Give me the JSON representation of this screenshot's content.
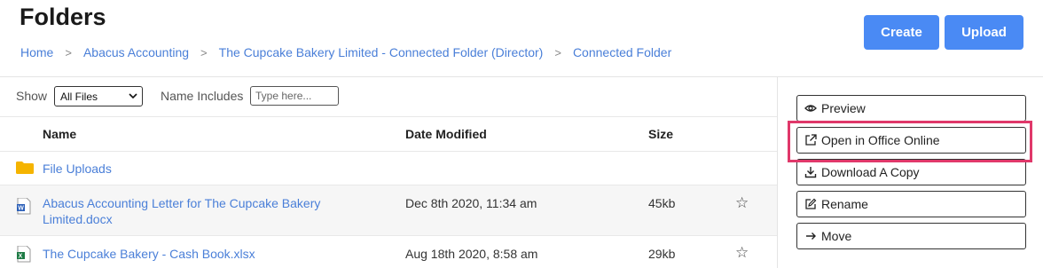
{
  "header": {
    "title": "Folders"
  },
  "breadcrumb": [
    "Home",
    "Abacus Accounting",
    "The Cupcake Bakery Limited - Connected Folder (Director)",
    "Connected Folder"
  ],
  "actions": {
    "create_label": "Create",
    "upload_label": "Upload"
  },
  "filters": {
    "show_label": "Show",
    "show_value": "All Files",
    "name_label": "Name Includes",
    "name_placeholder": "Type here..."
  },
  "table": {
    "columns": [
      "Name",
      "Date Modified",
      "Size"
    ],
    "rows": [
      {
        "type": "folder",
        "name": "File Uploads",
        "date": "",
        "size": ""
      },
      {
        "type": "docx",
        "name_line1": "Abacus Accounting Letter for The Cupcake Bakery",
        "name_line2": "Limited.docx",
        "date": "Dec 8th 2020, 11:34 am",
        "size": "45kb"
      },
      {
        "type": "xlsx",
        "name": "The Cupcake Bakery - Cash Book.xlsx",
        "date": "Aug 18th 2020, 8:58 am",
        "size": "29kb"
      }
    ]
  },
  "side_actions": {
    "preview": "Preview",
    "open_office": "Open in Office Online",
    "download": "Download A Copy",
    "rename": "Rename",
    "move": "Move"
  },
  "colors": {
    "accent": "#4a8af4",
    "link": "#4a7fd8",
    "highlight": "#e0386a",
    "folder": "#f5b400"
  }
}
